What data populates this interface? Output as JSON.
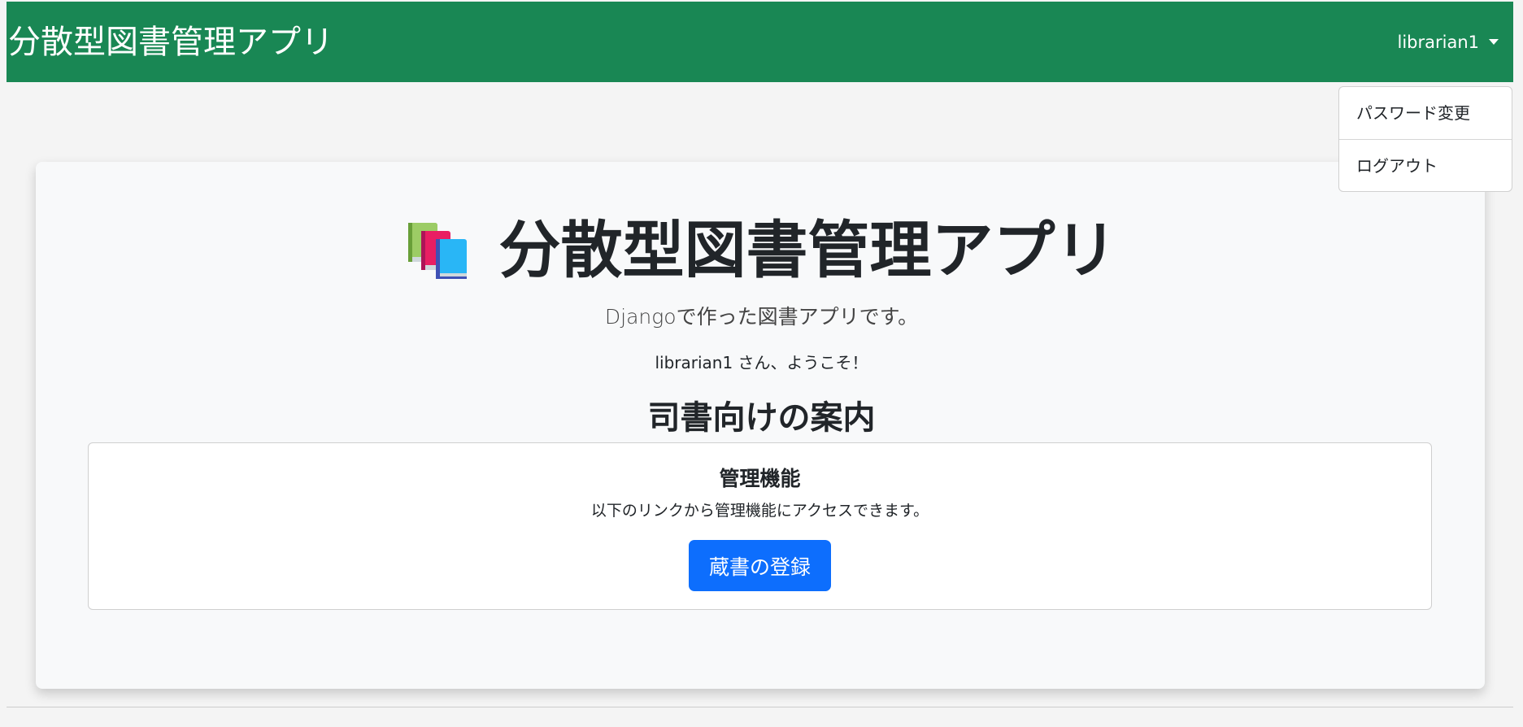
{
  "navbar": {
    "brand": "分散型図書管理アプリ",
    "user": "librarian1",
    "bg_color": "#198754"
  },
  "dropdown": {
    "items": [
      {
        "label": "パスワード変更"
      },
      {
        "label": "ログアウト"
      }
    ]
  },
  "hero": {
    "icon": "books-icon",
    "title": "分散型図書管理アプリ",
    "subtitle": "Djangoで作った図書アプリです。",
    "welcome": "librarian1 さん、ようこそ！"
  },
  "section": {
    "heading": "司書向けの案内"
  },
  "admin_panel": {
    "title": "管理機能",
    "description": "以下のリンクから管理機能にアクセスできます。",
    "button_label": "蔵書の登録",
    "button_color": "#0d6efd"
  }
}
